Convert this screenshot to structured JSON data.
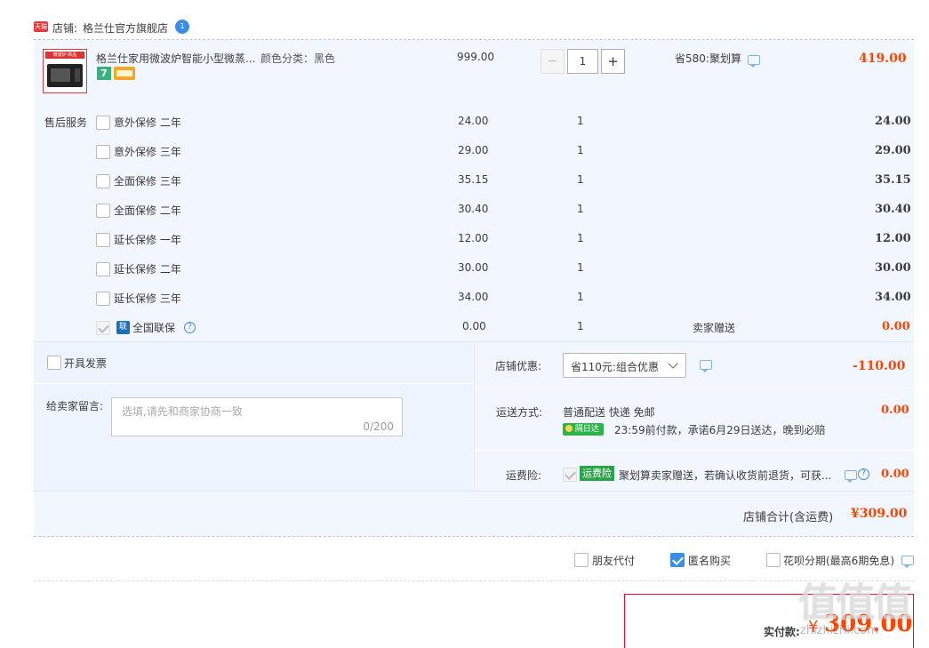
{
  "store": {
    "tmall_badge": "天猫",
    "label": "店铺:",
    "name": "格兰仕官方旗舰店",
    "ww_badge": "1"
  },
  "product": {
    "thumb_caption": "微波炉 新品",
    "title": "格兰仕家用微波炉智能小型微蒸...",
    "sku": "颜色分类：黑色",
    "badge_7": "7",
    "unit_price": "999.00",
    "quantity": "1",
    "minus": "−",
    "plus": "+",
    "promo": "省580:聚划算",
    "subtotal": "419.00"
  },
  "after_sale": {
    "label": "售后服务",
    "items": [
      {
        "name": "意外保修 二年",
        "price": "24.00",
        "qty": "1",
        "total": "24.00"
      },
      {
        "name": "意外保修 三年",
        "price": "29.00",
        "qty": "1",
        "total": "29.00"
      },
      {
        "name": "全面保修 三年",
        "price": "35.15",
        "qty": "1",
        "total": "35.15"
      },
      {
        "name": "全面保修 二年",
        "price": "30.40",
        "qty": "1",
        "total": "30.40"
      },
      {
        "name": "延长保修 一年",
        "price": "12.00",
        "qty": "1",
        "total": "12.00"
      },
      {
        "name": "延长保修 二年",
        "price": "30.00",
        "qty": "1",
        "total": "30.00"
      },
      {
        "name": "延长保修 三年",
        "price": "34.00",
        "qty": "1",
        "total": "34.00"
      }
    ],
    "lianbao": {
      "icon": "联",
      "name": "全国联保",
      "price": "0.00",
      "qty": "1",
      "note": "卖家赠送",
      "total": "0.00"
    }
  },
  "invoice": {
    "label": "开具发票"
  },
  "message": {
    "label": "给卖家留言:",
    "placeholder": "选填,请先和商家协商一致",
    "counter": "0/200"
  },
  "store_discount": {
    "label": "店铺优惠:",
    "selected": "省110元:组合优惠",
    "amount": "-110.00"
  },
  "shipping": {
    "label": "运送方式:",
    "method": "普通配送 快递 免邮",
    "badge": "隔日达",
    "promise": "23:59前付款，承诺6月29日送达，晚到必赔",
    "amount": "0.00"
  },
  "freight_insurance": {
    "label": "运费险:",
    "badge": "运费险",
    "text": "聚划算卖家赠送，若确认收货前退货，可获...",
    "amount": "0.00"
  },
  "store_total": {
    "label": "店铺合计(含运费)",
    "amount": "¥309.00"
  },
  "options": {
    "friend_pay": "朋友代付",
    "anonymous": "匿名购买",
    "huabei": "花呗分期(最高6期免息)"
  },
  "payment": {
    "label": "实付款:",
    "currency": "¥",
    "amount": "309.00"
  },
  "watermark": {
    "text": "值值值",
    "sub": "zhizhizhi.com"
  },
  "colors": {
    "accent": "#f40",
    "link": "#3a8ee6",
    "panel": "#f2f7ff"
  }
}
